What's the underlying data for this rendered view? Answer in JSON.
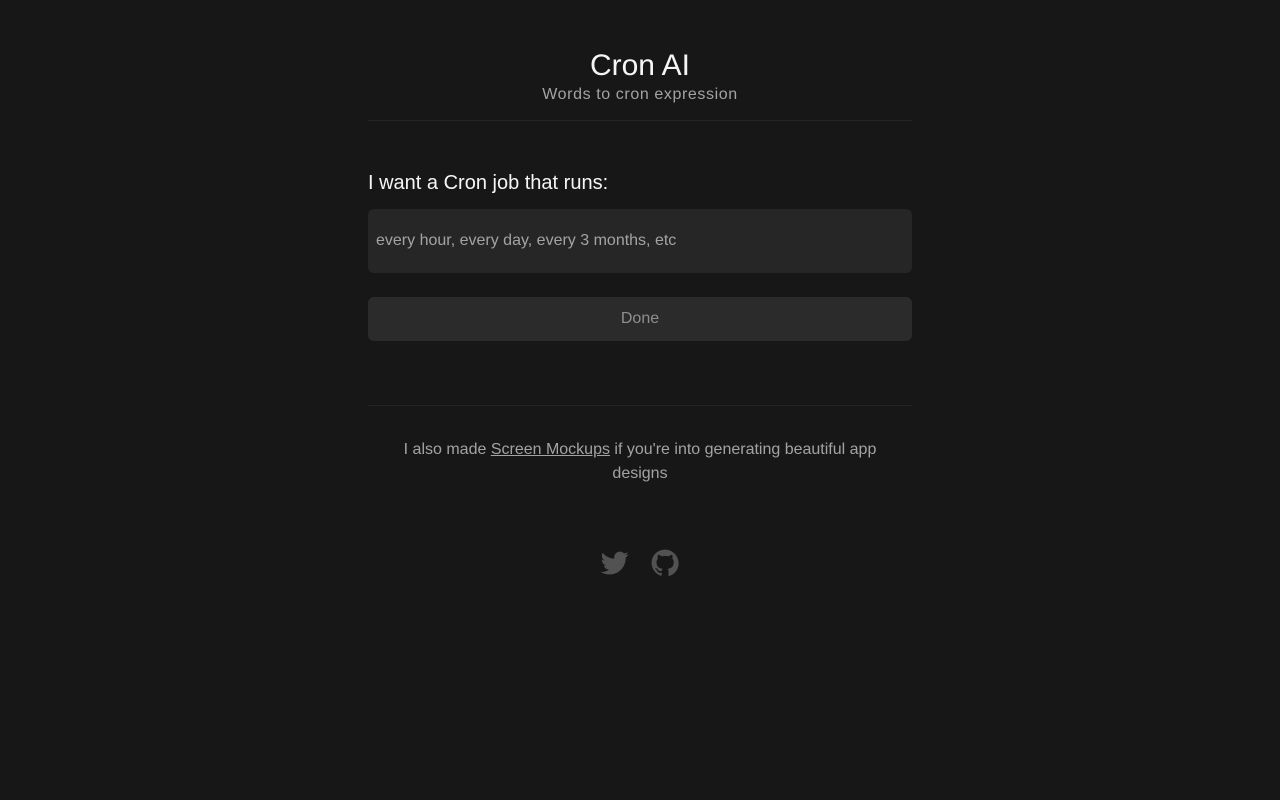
{
  "header": {
    "title": "Cron AI",
    "subtitle": "Words to cron expression"
  },
  "form": {
    "label": "I want a Cron job that runs:",
    "input_value": "",
    "input_placeholder": "every hour, every day, every 3 months, etc",
    "submit_label": "Done"
  },
  "footer": {
    "promo_prefix": "I also made ",
    "promo_link": "Screen Mockups",
    "promo_suffix": " if you're into generating beautiful app designs",
    "socials": [
      {
        "icon": "twitter-icon"
      },
      {
        "icon": "github-icon"
      }
    ]
  },
  "colors": {
    "background": "#171717",
    "input_bg": "#262626",
    "button_bg": "#2b2b2b",
    "muted_text": "#a3a3a3",
    "icon": "#525252"
  }
}
